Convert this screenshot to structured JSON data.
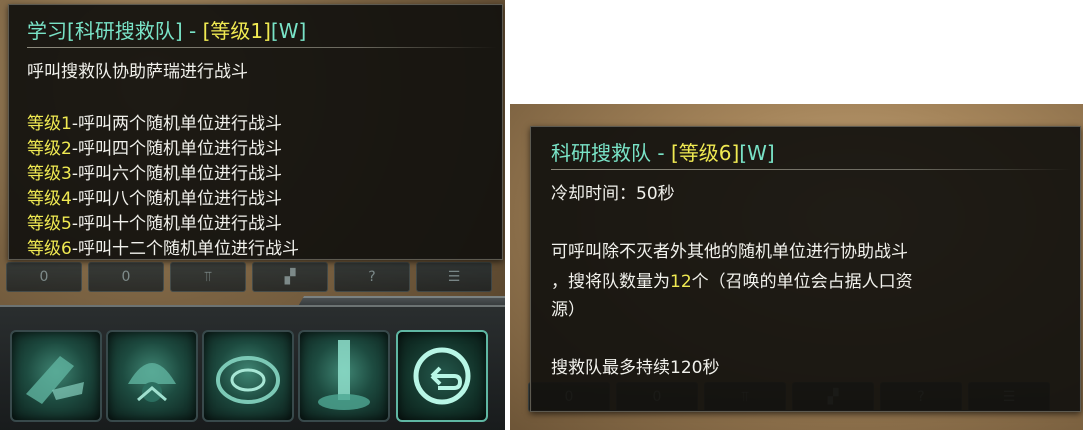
{
  "left_tooltip": {
    "title_prefix": "学习",
    "title_bracket_open": "[",
    "skill_name": "科研搜救队",
    "title_bracket_close": "]",
    "title_separator": " - ",
    "level_tag": "[等级1]",
    "hotkey": "[W]",
    "description": "呼叫搜救队协助萨瑞进行战斗",
    "levels": [
      {
        "label": "等级1",
        "text": "-呼叫两个随机单位进行战斗"
      },
      {
        "label": "等级2",
        "text": "-呼叫四个随机单位进行战斗"
      },
      {
        "label": "等级3",
        "text": "-呼叫六个随机单位进行战斗"
      },
      {
        "label": "等级4",
        "text": "-呼叫八个随机单位进行战斗"
      },
      {
        "label": "等级5",
        "text": "-呼叫十个随机单位进行战斗"
      },
      {
        "label": "等级6",
        "text": "-呼叫十二个随机单位进行战斗"
      }
    ]
  },
  "right_tooltip": {
    "skill_name": "科研搜救队",
    "title_separator": " - ",
    "level_tag": "[等级6]",
    "hotkey": "[W]",
    "cooldown": "冷却时间：50秒",
    "desc_line1": "可呼叫除不灭者外其他的随机单位进行协助战斗",
    "desc_line2_a": "，搜将队数量为",
    "desc_line2_count": "12",
    "desc_line2_b": "个（召唤的单位会占据人口资",
    "desc_line3": "源）",
    "duration": "搜救队最多持续120秒"
  },
  "command_bar": {
    "buttons": [
      {
        "label": "0"
      },
      {
        "label": "0"
      },
      {
        "label": "⫪"
      },
      {
        "label": "▞"
      },
      {
        "label": "?"
      },
      {
        "label": "☰"
      }
    ]
  },
  "ability_bar": {
    "slots": [
      {
        "icon": "rifle-strike-icon"
      },
      {
        "icon": "drone-swarm-icon"
      },
      {
        "icon": "vortex-shield-icon"
      },
      {
        "icon": "orbital-beam-icon"
      },
      {
        "icon": "return-arrow-icon"
      }
    ]
  },
  "colors": {
    "title": "#79e3c7",
    "level_highlight": "#f0ea52",
    "body_text": "#f1f1ec",
    "tooltip_bg": "#12110e"
  }
}
